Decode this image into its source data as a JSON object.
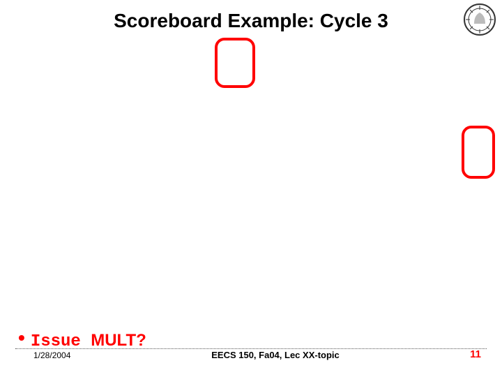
{
  "slide": {
    "title": "Scoreboard Example: Cycle 3"
  },
  "bullet": {
    "issue_word": "Issue",
    "mult_word": "MULT?"
  },
  "footer": {
    "date": "1/28/2004",
    "center": "EECS 150, Fa04, Lec XX-topic",
    "page": "11"
  },
  "icons": {
    "seal": "university-seal-icon"
  }
}
